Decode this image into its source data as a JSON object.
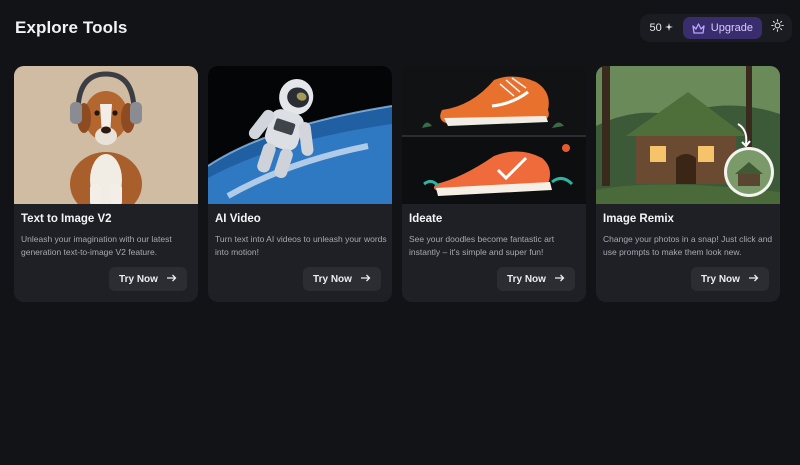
{
  "header": {
    "title": "Explore Tools",
    "credits": "50",
    "upgrade_label": "Upgrade"
  },
  "cards": [
    {
      "title": "Text to Image V2",
      "description": "Unleash your imagination with our latest generation text-to-image V2 feature.",
      "button": "Try Now",
      "image": "dog-with-headphones"
    },
    {
      "title": "AI Video",
      "description": "Turn text into AI videos to unleash your words into motion!",
      "button": "Try Now",
      "image": "astronaut-over-earth"
    },
    {
      "title": "Ideate",
      "description": "See your doodles become fantastic art instantly – it's simple and super fun!",
      "button": "Try Now",
      "image": "orange-sneakers"
    },
    {
      "title": "Image Remix",
      "description": "Change your photos in a snap! Just click and use prompts to make them look new.",
      "button": "Try Now",
      "image": "fantasy-cottage"
    }
  ],
  "colors": {
    "background": "#121317",
    "card": "#1f2025",
    "upgrade_bg": "#3a2d6e",
    "upgrade_text": "#d8ccff"
  }
}
